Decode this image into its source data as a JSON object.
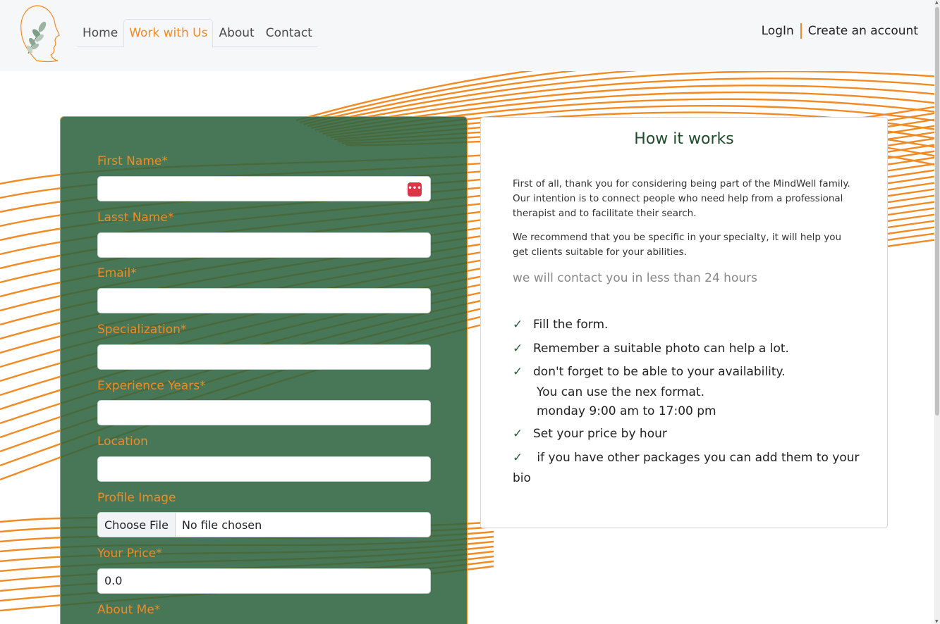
{
  "nav": {
    "items": [
      {
        "label": "Home",
        "active": false
      },
      {
        "label": "Work with Us",
        "active": true
      },
      {
        "label": "About",
        "active": false
      },
      {
        "label": "Contact",
        "active": false
      }
    ],
    "login_label": "LogIn",
    "create_account_label": "Create an account"
  },
  "form": {
    "first_name_label": "First Name*",
    "last_name_label": "Lasst Name*",
    "email_label": "Email*",
    "specialization_label": "Specialization*",
    "experience_label": "Experience Years*",
    "location_label": "Location",
    "profile_image_label": "Profile Image",
    "choose_file_label": "Choose File",
    "no_file_text": "No file chosen",
    "price_label": "Your Price*",
    "price_value": "0.0",
    "about_label": "About Me*"
  },
  "info": {
    "title": "How it works",
    "para1": "First of all, thank you for considering being part of the MindWell family. Our intention is to connect people who need help from a professional therapist and to facilitate their search.",
    "para2": "We recommend that you be specific in your specialty, it will help you get clients suitable for your abilities.",
    "note": "we will contact you in less than 24 hours",
    "steps": [
      "Fill the form.",
      "Remember a suitable photo can help a lot.",
      "don't forget to be able to your availability.",
      "Set your price by hour",
      " if you have other packages you can add them to your"
    ],
    "availability_line1": "You can use the nex format.",
    "availability_line2": "monday 9:00 am to 17:00 pm",
    "last_step_cont": "bio",
    "check_icon": "checkmark-icon"
  },
  "colors": {
    "accent": "#f28a23",
    "panel_green": "#2f6440",
    "title_green": "#1f4d2b"
  }
}
